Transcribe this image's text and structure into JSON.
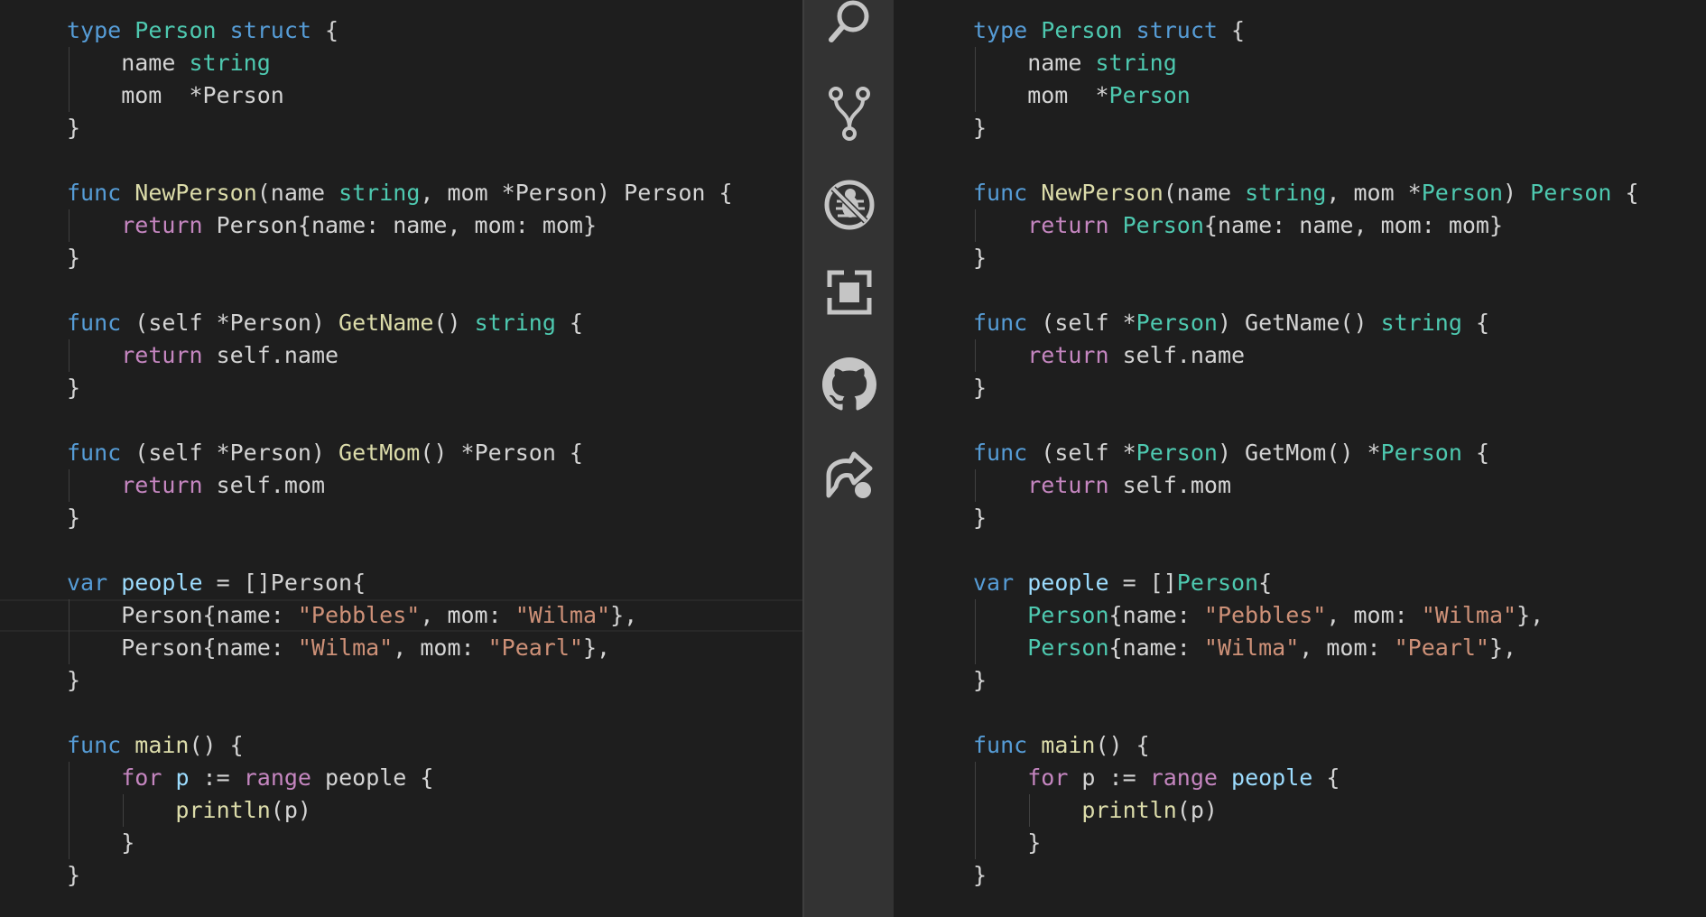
{
  "colors": {
    "editor_bg": "#1e1e1e",
    "activity_bar_bg": "#333333",
    "keyword": "#569cd6",
    "type": "#4ec9b0",
    "function": "#dcdcaa",
    "control": "#c586c0",
    "string": "#ce9178",
    "variable": "#9cdcfe",
    "plain": "#d4d4d4",
    "icon": "#c5c5c5"
  },
  "activity_bar": {
    "items": [
      {
        "name": "search-icon"
      },
      {
        "name": "source-control-icon"
      },
      {
        "name": "debug-icon"
      },
      {
        "name": "extensions-icon"
      },
      {
        "name": "github-icon"
      },
      {
        "name": "live-share-icon"
      }
    ]
  },
  "editors": [
    {
      "name": "editor-left",
      "lines": [
        [
          [
            "t-kw",
            "type"
          ],
          [
            "t-plain",
            " "
          ],
          [
            "t-ty",
            "Person"
          ],
          [
            "t-plain",
            " "
          ],
          [
            "t-kw",
            "struct"
          ],
          [
            "t-plain",
            " {"
          ]
        ],
        [
          [
            "t-plain",
            "    name "
          ],
          [
            "t-ty",
            "string"
          ]
        ],
        [
          [
            "t-plain",
            "    mom  *Person"
          ]
        ],
        [
          [
            "t-plain",
            "}"
          ]
        ],
        [],
        [
          [
            "t-kw",
            "func"
          ],
          [
            "t-plain",
            " "
          ],
          [
            "t-fn",
            "NewPerson"
          ],
          [
            "t-plain",
            "(name "
          ],
          [
            "t-ty",
            "string"
          ],
          [
            "t-plain",
            ", mom *Person) Person {"
          ]
        ],
        [
          [
            "t-plain",
            "    "
          ],
          [
            "t-ctl",
            "return"
          ],
          [
            "t-plain",
            " Person{name: name, mom: mom}"
          ]
        ],
        [
          [
            "t-plain",
            "}"
          ]
        ],
        [],
        [
          [
            "t-kw",
            "func"
          ],
          [
            "t-plain",
            " (self *Person) "
          ],
          [
            "t-fn",
            "GetName"
          ],
          [
            "t-plain",
            "() "
          ],
          [
            "t-ty",
            "string"
          ],
          [
            "t-plain",
            " {"
          ]
        ],
        [
          [
            "t-plain",
            "    "
          ],
          [
            "t-ctl",
            "return"
          ],
          [
            "t-plain",
            " self.name"
          ]
        ],
        [
          [
            "t-plain",
            "}"
          ]
        ],
        [],
        [
          [
            "t-kw",
            "func"
          ],
          [
            "t-plain",
            " (self *Person) "
          ],
          [
            "t-fn",
            "GetMom"
          ],
          [
            "t-plain",
            "() *Person {"
          ]
        ],
        [
          [
            "t-plain",
            "    "
          ],
          [
            "t-ctl",
            "return"
          ],
          [
            "t-plain",
            " self.mom"
          ]
        ],
        [
          [
            "t-plain",
            "}"
          ]
        ],
        [],
        [
          [
            "t-kw",
            "var"
          ],
          [
            "t-plain",
            " "
          ],
          [
            "t-var",
            "people"
          ],
          [
            "t-plain",
            " = []Person{"
          ]
        ],
        [
          [
            "t-plain",
            "    Person{name: "
          ],
          [
            "t-str",
            "\"Pebbles\""
          ],
          [
            "t-plain",
            ", mom: "
          ],
          [
            "t-str",
            "\"Wilma\""
          ],
          [
            "t-plain",
            "},"
          ]
        ],
        [
          [
            "t-plain",
            "    Person{name: "
          ],
          [
            "t-str",
            "\"Wilma\""
          ],
          [
            "t-plain",
            ", mom: "
          ],
          [
            "t-str",
            "\"Pearl\""
          ],
          [
            "t-plain",
            "},"
          ]
        ],
        [
          [
            "t-plain",
            "}"
          ]
        ],
        [],
        [
          [
            "t-kw",
            "func"
          ],
          [
            "t-plain",
            " "
          ],
          [
            "t-fn",
            "main"
          ],
          [
            "t-plain",
            "() {"
          ]
        ],
        [
          [
            "t-plain",
            "    "
          ],
          [
            "t-ctl",
            "for"
          ],
          [
            "t-plain",
            " "
          ],
          [
            "t-var",
            "p"
          ],
          [
            "t-plain",
            " := "
          ],
          [
            "t-ctl",
            "range"
          ],
          [
            "t-plain",
            " people {"
          ]
        ],
        [
          [
            "t-plain",
            "        "
          ],
          [
            "t-fn",
            "println"
          ],
          [
            "t-plain",
            "(p)"
          ]
        ],
        [
          [
            "t-plain",
            "    }"
          ]
        ],
        [
          [
            "t-plain",
            "}"
          ]
        ]
      ]
    },
    {
      "name": "editor-right",
      "lines": [
        [
          [
            "t-kw",
            "type"
          ],
          [
            "t-plain",
            " "
          ],
          [
            "t-ty",
            "Person"
          ],
          [
            "t-plain",
            " "
          ],
          [
            "t-kw",
            "struct"
          ],
          [
            "t-plain",
            " {"
          ]
        ],
        [
          [
            "t-plain",
            "    name "
          ],
          [
            "t-ty",
            "string"
          ]
        ],
        [
          [
            "t-plain",
            "    mom  *"
          ],
          [
            "t-ty",
            "Person"
          ]
        ],
        [
          [
            "t-plain",
            "}"
          ]
        ],
        [],
        [
          [
            "t-kw",
            "func"
          ],
          [
            "t-plain",
            " "
          ],
          [
            "t-fn",
            "NewPerson"
          ],
          [
            "t-plain",
            "(name "
          ],
          [
            "t-ty",
            "string"
          ],
          [
            "t-plain",
            ", mom *"
          ],
          [
            "t-ty",
            "Person"
          ],
          [
            "t-plain",
            ") "
          ],
          [
            "t-ty",
            "Person"
          ],
          [
            "t-plain",
            " {"
          ]
        ],
        [
          [
            "t-plain",
            "    "
          ],
          [
            "t-ctl",
            "return"
          ],
          [
            "t-plain",
            " "
          ],
          [
            "t-ty",
            "Person"
          ],
          [
            "t-plain",
            "{name: name, mom: mom}"
          ]
        ],
        [
          [
            "t-plain",
            "}"
          ]
        ],
        [],
        [
          [
            "t-kw",
            "func"
          ],
          [
            "t-plain",
            " (self *"
          ],
          [
            "t-ty",
            "Person"
          ],
          [
            "t-plain",
            ") GetName() "
          ],
          [
            "t-ty",
            "string"
          ],
          [
            "t-plain",
            " {"
          ]
        ],
        [
          [
            "t-plain",
            "    "
          ],
          [
            "t-ctl",
            "return"
          ],
          [
            "t-plain",
            " self.name"
          ]
        ],
        [
          [
            "t-plain",
            "}"
          ]
        ],
        [],
        [
          [
            "t-kw",
            "func"
          ],
          [
            "t-plain",
            " (self *"
          ],
          [
            "t-ty",
            "Person"
          ],
          [
            "t-plain",
            ") GetMom() *"
          ],
          [
            "t-ty",
            "Person"
          ],
          [
            "t-plain",
            " {"
          ]
        ],
        [
          [
            "t-plain",
            "    "
          ],
          [
            "t-ctl",
            "return"
          ],
          [
            "t-plain",
            " self.mom"
          ]
        ],
        [
          [
            "t-plain",
            "}"
          ]
        ],
        [],
        [
          [
            "t-kw",
            "var"
          ],
          [
            "t-plain",
            " "
          ],
          [
            "t-var",
            "people"
          ],
          [
            "t-plain",
            " = []"
          ],
          [
            "t-ty",
            "Person"
          ],
          [
            "t-plain",
            "{"
          ]
        ],
        [
          [
            "t-plain",
            "    "
          ],
          [
            "t-ty",
            "Person"
          ],
          [
            "t-plain",
            "{name: "
          ],
          [
            "t-str",
            "\"Pebbles\""
          ],
          [
            "t-plain",
            ", mom: "
          ],
          [
            "t-str",
            "\"Wilma\""
          ],
          [
            "t-plain",
            "},"
          ]
        ],
        [
          [
            "t-plain",
            "    "
          ],
          [
            "t-ty",
            "Person"
          ],
          [
            "t-plain",
            "{name: "
          ],
          [
            "t-str",
            "\"Wilma\""
          ],
          [
            "t-plain",
            ", mom: "
          ],
          [
            "t-str",
            "\"Pearl\""
          ],
          [
            "t-plain",
            "},"
          ]
        ],
        [
          [
            "t-plain",
            "}"
          ]
        ],
        [],
        [
          [
            "t-kw",
            "func"
          ],
          [
            "t-plain",
            " "
          ],
          [
            "t-fn",
            "main"
          ],
          [
            "t-plain",
            "() {"
          ]
        ],
        [
          [
            "t-plain",
            "    "
          ],
          [
            "t-ctl",
            "for"
          ],
          [
            "t-plain",
            " p := "
          ],
          [
            "t-ctl",
            "range"
          ],
          [
            "t-plain",
            " "
          ],
          [
            "t-var",
            "people"
          ],
          [
            "t-plain",
            " {"
          ]
        ],
        [
          [
            "t-plain",
            "        "
          ],
          [
            "t-fn",
            "println"
          ],
          [
            "t-plain",
            "(p)"
          ]
        ],
        [
          [
            "t-plain",
            "    }"
          ]
        ],
        [
          [
            "t-plain",
            "}"
          ]
        ]
      ]
    }
  ]
}
